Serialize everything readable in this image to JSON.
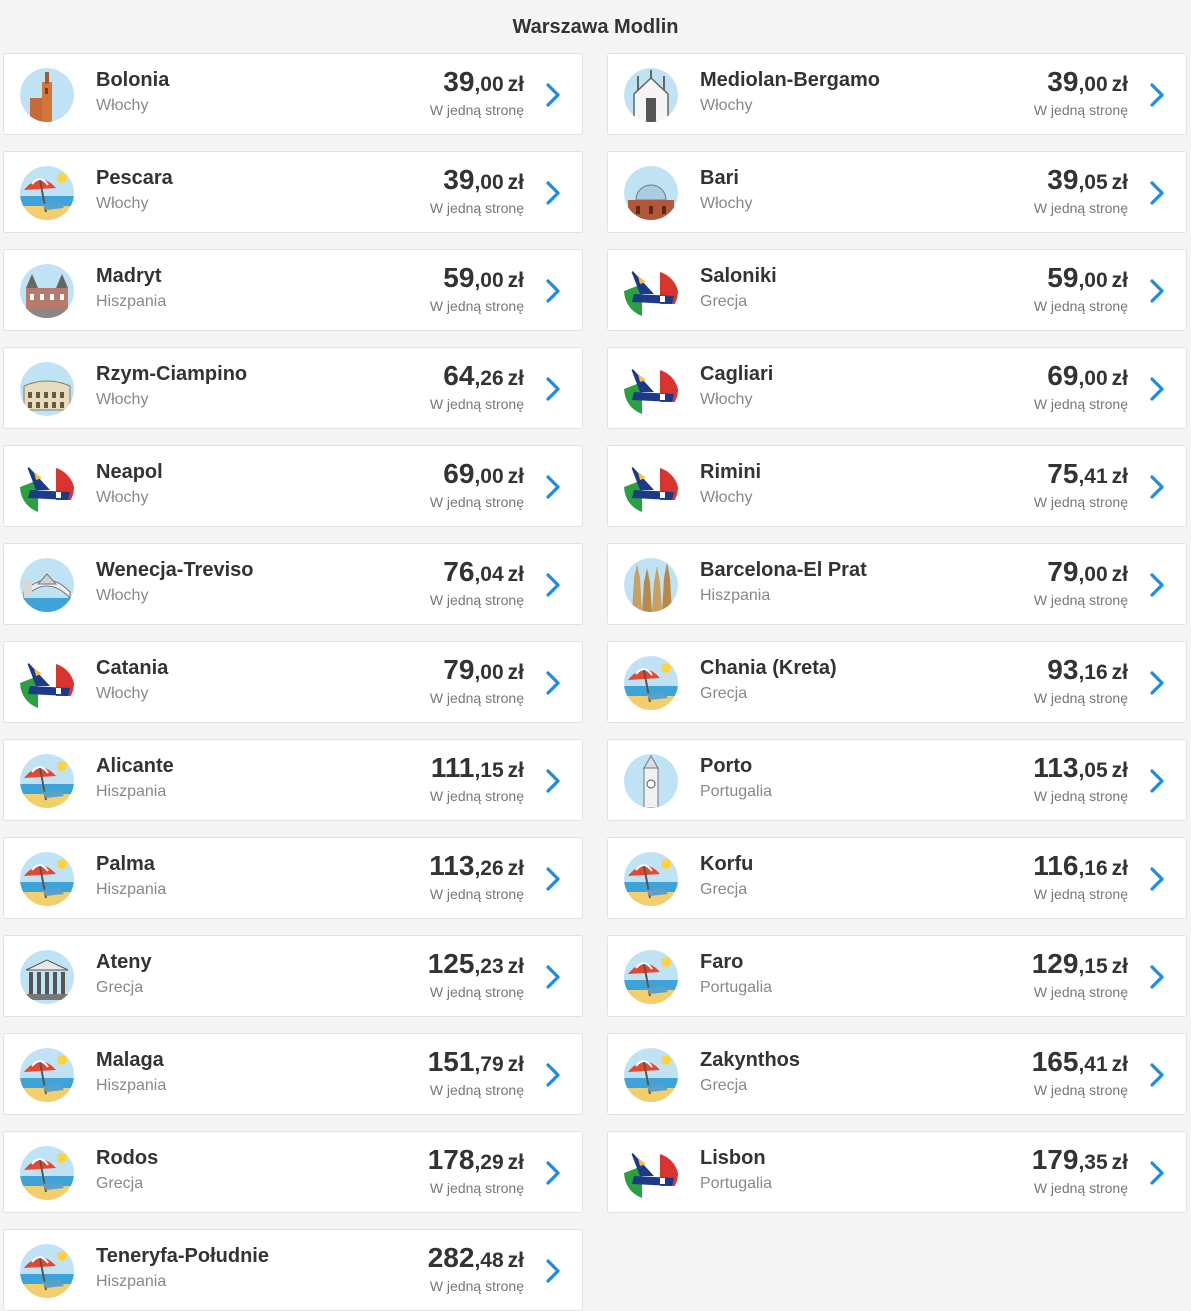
{
  "origin": "Warszawa Modlin",
  "one_way_label": "W jedną stronę",
  "currency": "zł",
  "colors": {
    "accent": "#1a8ce6",
    "text": "#333333",
    "muted": "#888888"
  },
  "destinations": [
    {
      "city": "Bolonia",
      "country": "Włochy",
      "price_int": "39",
      "price_dec": ",00",
      "icon": "tower-icon"
    },
    {
      "city": "Mediolan-Bergamo",
      "country": "Włochy",
      "price_int": "39",
      "price_dec": ",00",
      "icon": "cathedral-icon"
    },
    {
      "city": "Pescara",
      "country": "Włochy",
      "price_int": "39",
      "price_dec": ",00",
      "icon": "beach-umbrella-icon"
    },
    {
      "city": "Bari",
      "country": "Włochy",
      "price_int": "39",
      "price_dec": ",05",
      "icon": "dome-icon"
    },
    {
      "city": "Madryt",
      "country": "Hiszpania",
      "price_int": "59",
      "price_dec": ",00",
      "icon": "palace-icon"
    },
    {
      "city": "Saloniki",
      "country": "Grecja",
      "price_int": "59",
      "price_dec": ",00",
      "icon": "plane-flag-icon"
    },
    {
      "city": "Rzym-Ciampino",
      "country": "Włochy",
      "price_int": "64",
      "price_dec": ",26",
      "icon": "colosseum-icon"
    },
    {
      "city": "Cagliari",
      "country": "Włochy",
      "price_int": "69",
      "price_dec": ",00",
      "icon": "plane-flag-icon"
    },
    {
      "city": "Neapol",
      "country": "Włochy",
      "price_int": "69",
      "price_dec": ",00",
      "icon": "plane-flag-icon"
    },
    {
      "city": "Rimini",
      "country": "Włochy",
      "price_int": "75",
      "price_dec": ",41",
      "icon": "plane-flag-icon"
    },
    {
      "city": "Wenecja-Treviso",
      "country": "Włochy",
      "price_int": "76",
      "price_dec": ",04",
      "icon": "bridge-icon"
    },
    {
      "city": "Barcelona-El Prat",
      "country": "Hiszpania",
      "price_int": "79",
      "price_dec": ",00",
      "icon": "basilica-icon"
    },
    {
      "city": "Catania",
      "country": "Włochy",
      "price_int": "79",
      "price_dec": ",00",
      "icon": "plane-flag-icon"
    },
    {
      "city": "Chania (Kreta)",
      "country": "Grecja",
      "price_int": "93",
      "price_dec": ",16",
      "icon": "beach-umbrella-icon"
    },
    {
      "city": "Alicante",
      "country": "Hiszpania",
      "price_int": "111",
      "price_dec": ",15",
      "icon": "beach-umbrella-icon"
    },
    {
      "city": "Porto",
      "country": "Portugalia",
      "price_int": "113",
      "price_dec": ",05",
      "icon": "clock-tower-icon"
    },
    {
      "city": "Palma",
      "country": "Hiszpania",
      "price_int": "113",
      "price_dec": ",26",
      "icon": "beach-umbrella-icon"
    },
    {
      "city": "Korfu",
      "country": "Grecja",
      "price_int": "116",
      "price_dec": ",16",
      "icon": "beach-umbrella-icon"
    },
    {
      "city": "Ateny",
      "country": "Grecja",
      "price_int": "125",
      "price_dec": ",23",
      "icon": "temple-icon"
    },
    {
      "city": "Faro",
      "country": "Portugalia",
      "price_int": "129",
      "price_dec": ",15",
      "icon": "beach-umbrella-icon"
    },
    {
      "city": "Malaga",
      "country": "Hiszpania",
      "price_int": "151",
      "price_dec": ",79",
      "icon": "beach-umbrella-icon"
    },
    {
      "city": "Zakynthos",
      "country": "Grecja",
      "price_int": "165",
      "price_dec": ",41",
      "icon": "beach-umbrella-icon"
    },
    {
      "city": "Rodos",
      "country": "Grecja",
      "price_int": "178",
      "price_dec": ",29",
      "icon": "beach-umbrella-icon"
    },
    {
      "city": "Lisbon",
      "country": "Portugalia",
      "price_int": "179",
      "price_dec": ",35",
      "icon": "plane-flag-icon"
    },
    {
      "city": "Teneryfa-Południe",
      "country": "Hiszpania",
      "price_int": "282",
      "price_dec": ",48",
      "icon": "beach-umbrella-icon"
    }
  ]
}
